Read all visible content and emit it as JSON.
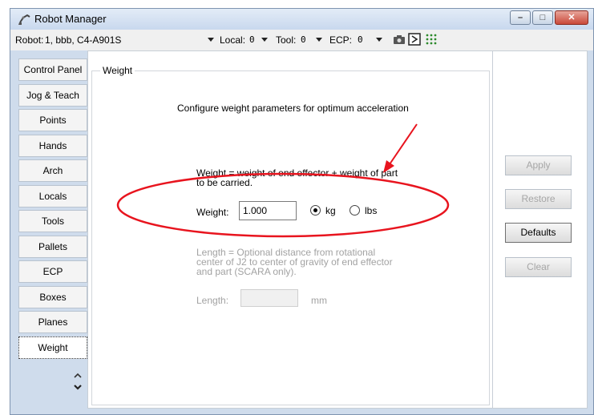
{
  "window": {
    "title": "Robot Manager",
    "buttons": {
      "minimize": "–",
      "maximize": "□",
      "close": "✕"
    }
  },
  "toolbar": {
    "robot_label": "Robot:",
    "robot_value": "1, bbb, C4-A901S",
    "local_label": "Local:",
    "local_value": "0",
    "tool_label": "Tool:",
    "tool_value": "0",
    "ecp_label": "ECP:",
    "ecp_value": "0"
  },
  "tabs": [
    "Control Panel",
    "Jog & Teach",
    "Points",
    "Hands",
    "Arch",
    "Locals",
    "Tools",
    "Pallets",
    "ECP",
    "Boxes",
    "Planes",
    "Weight"
  ],
  "active_tab": "Weight",
  "weight_panel": {
    "group_title": "Weight",
    "heading": "Configure weight parameters for optimum acceleration",
    "description_line1": "Weight = weight of end effector + weight of part",
    "description_line2": "to be carried.",
    "weight_label": "Weight:",
    "weight_value": "1.000",
    "unit_kg": "kg",
    "unit_lbs": "lbs",
    "selected_unit": "kg",
    "length_desc_line1": "Length = Optional distance from rotational",
    "length_desc_line2": "center of J2 to center of gravity of end effector",
    "length_desc_line3": "and part (SCARA only).",
    "length_label": "Length:",
    "length_value": "",
    "length_unit": "mm"
  },
  "side_buttons": {
    "apply": "Apply",
    "restore": "Restore",
    "defaults": "Defaults",
    "clear": "Clear"
  },
  "colors": {
    "annotation": "#e8141e",
    "titlebar": "#d3e1f2",
    "close_button": "#c9493a"
  }
}
